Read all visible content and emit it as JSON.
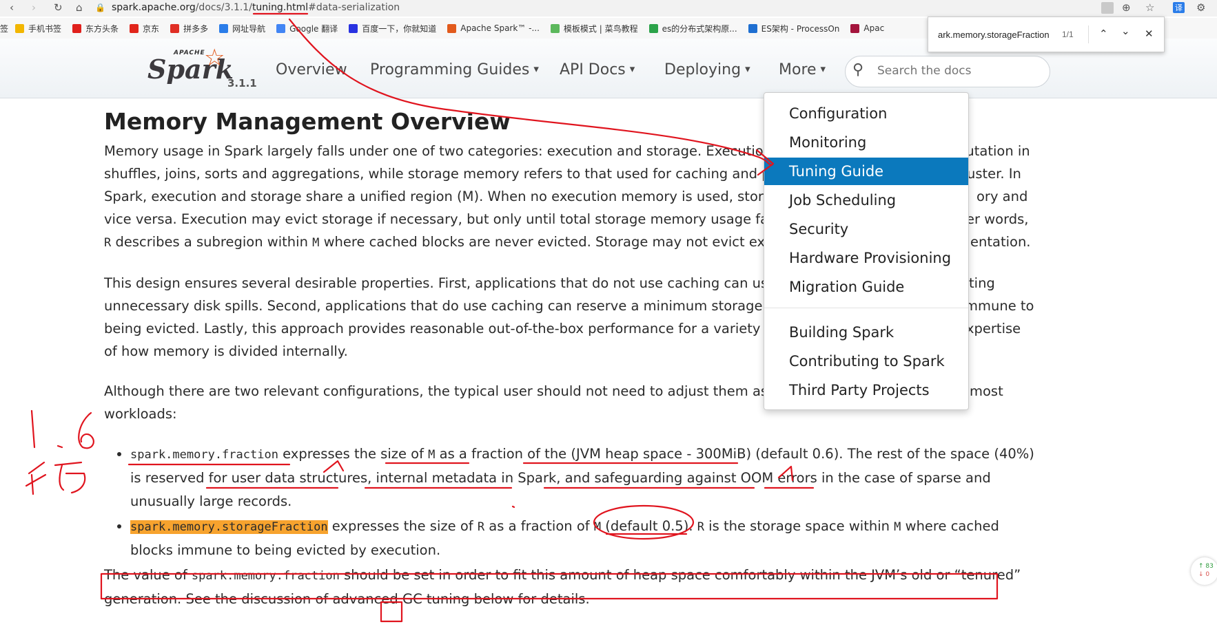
{
  "browser": {
    "url_host": "spark.apache.org",
    "url_path_pre": "/docs/3.1.1/",
    "url_path_page": "tuning.html",
    "url_hash": "#data-serialization",
    "bookmarks": [
      {
        "label": "手机书签",
        "color": "#f2b600"
      },
      {
        "label": "东方头条",
        "color": "#e0201c"
      },
      {
        "label": "京东",
        "color": "#e1251b"
      },
      {
        "label": "拼多多",
        "color": "#e02e24"
      },
      {
        "label": "网址导航",
        "color": "#2b7de9"
      },
      {
        "label": "Google 翻译",
        "color": "#4285f4"
      },
      {
        "label": "百度一下，你就知道",
        "color": "#2932e1"
      },
      {
        "label": "Apache Spark™ -...",
        "color": "#e25a1c"
      },
      {
        "label": "模板模式 | 菜鸟教程",
        "color": "#5cb85c"
      },
      {
        "label": "es的分布式架构原...",
        "color": "#2ca34a"
      },
      {
        "label": "ES架构 - ProcessOn",
        "color": "#1f6fd1"
      },
      {
        "label": "Apac",
        "color": "#a4143c"
      }
    ]
  },
  "find_bar": {
    "query": "ark.memory.storageFraction",
    "count": "1/1"
  },
  "navbar": {
    "logo_apache": "APACHE",
    "logo_spark": "Spark",
    "version": "3.1.1",
    "items": [
      "Overview",
      "Programming Guides",
      "API Docs",
      "Deploying",
      "More"
    ],
    "search_placeholder": "Search the docs"
  },
  "dropdown": {
    "items": [
      "Configuration",
      "Monitoring",
      "Tuning Guide",
      "Job Scheduling",
      "Security",
      "Hardware Provisioning",
      "Migration Guide",
      "Building Spark",
      "Contributing to Spark",
      "Third Party Projects"
    ],
    "active": "Tuning Guide"
  },
  "content": {
    "heading": "Memory Management Overview",
    "p1": {
      "l1": "Memory usage in Spark largely falls under one of two categories: execution and storage. Execution men",
      "l1r": "putation in",
      "l2": "shuffles, joins, sorts and aggregations, while storage memory refers to that used for caching and propag",
      "l2r": "uster. In",
      "l3": "Spark, execution and storage share a unified region (M). When no execution memory is used, storage ca",
      "l3r": "ory and",
      "l4": "vice versa. Execution may evict storage if necessary, but only until total storage memory usage falls unde",
      "l4r": "er words,",
      "l5a": "R",
      "l5b": " describes a subregion within ",
      "l5c": "M",
      "l5d": " where cached blocks are never evicted. Storage may not evict executio",
      "l5r": "entation."
    },
    "p2": {
      "l1": "This design ensures several desirable properties. First, applications that do not use caching can use the e",
      "l1r": "ting",
      "l2": "unnecessary disk spills. Second, applications that do use caching can reserve a minimum storage space (",
      "l2r": "mmune to",
      "l3": "being evicted. Lastly, this approach provides reasonable out-of-the-box performance for a variety of wo",
      "l3r": "xpertise",
      "l4": "of how memory is divided internally."
    },
    "p3": {
      "l1": "Although there are two relevant configurations, the typical user should not need to adjust them as the c",
      "l1r": "most",
      "l2": "workloads:"
    },
    "bullet1": {
      "code": "spark.memory.fraction",
      "t1": " expresses the size of ",
      "m": "M",
      "t2": " as a fraction of the (JVM heap space - 300MiB) (default 0.6). The rest of the space (40%) is reserved for user data structures, internal metadata in Spark, and safeguarding against OOM errors in the case of sparse and unusually large records."
    },
    "bullet2": {
      "code": "spark.memory.storageFraction",
      "t1": " expresses the size of ",
      "r": "R",
      "t2": " as a fraction of ",
      "m": "M",
      "t3": " (default 0.5). ",
      "r2": "R",
      "t4": " is the storage space within ",
      "m2": "M",
      "t5": " where cached blocks immune to being evicted by execution."
    },
    "p4": {
      "t1": "The value of ",
      "code": "spark.memory.fraction",
      "t2": " should be set in order to fit this amount of heap space comfortably within the JVM’s old or “tenured”",
      "t3": "generation. See the discussion of advanced ",
      "gc": "GC",
      "t4": " tuning below for details."
    }
  },
  "side_widget": {
    "up": "83",
    "down": "0"
  },
  "colors": {
    "accent": "#0b79bd",
    "annotation": "#e0141e",
    "highlight": "#f7a32e",
    "spark_orange": "#e25a1c"
  }
}
